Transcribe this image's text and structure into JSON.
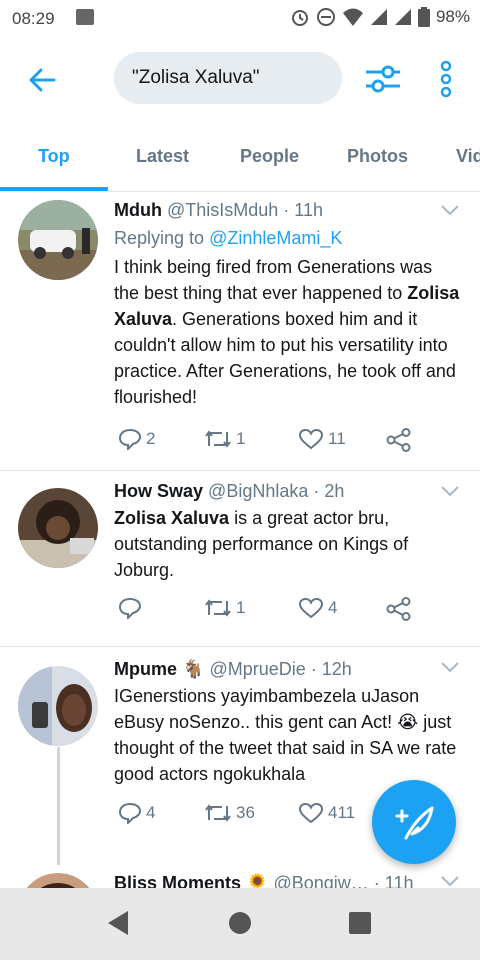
{
  "status_bar": {
    "time": "08:29",
    "battery": "98%"
  },
  "search": {
    "query": "\"Zolisa Xaluva\""
  },
  "tabs": [
    "Top",
    "Latest",
    "People",
    "Photos",
    "Vid"
  ],
  "tweets": [
    {
      "name": "Mduh",
      "handle": "@ThisIsMduh · 11h",
      "replying_prefix": "Replying to ",
      "replying_to": "@ZinhleMami_K",
      "text_a": "I think being fired from Generations was the best thing that ever happened to ",
      "text_bold": "Zolisa Xaluva",
      "text_b": ". Generations boxed him and it couldn't allow him to put his versatility into practice. After Generations,  he took off and flourished!",
      "replies": "2",
      "retweets": "1",
      "likes": "11"
    },
    {
      "name": "How Sway",
      "handle": "@BigNhlaka · 2h",
      "text_bold": "Zolisa Xaluva",
      "text_b": " is a great actor bru, outstanding performance on Kings of Joburg.",
      "replies": "",
      "retweets": "1",
      "likes": "4"
    },
    {
      "name": "Mpume 🐐",
      "handle": "@MprueDie · 12h",
      "text_a": "IGenerstions yayimbambezela uJason eBusy noSenzo.. this gent can Act! 😭 just thought of the tweet that said in SA we rate good actors ngokukhala",
      "replies": "4",
      "retweets": "36",
      "likes": "411"
    },
    {
      "name": "Bliss Moments 🌻",
      "handle": "@Bongiw… · 11h"
    }
  ],
  "colors": {
    "accent": "#1da1f2",
    "muted": "#657786"
  }
}
